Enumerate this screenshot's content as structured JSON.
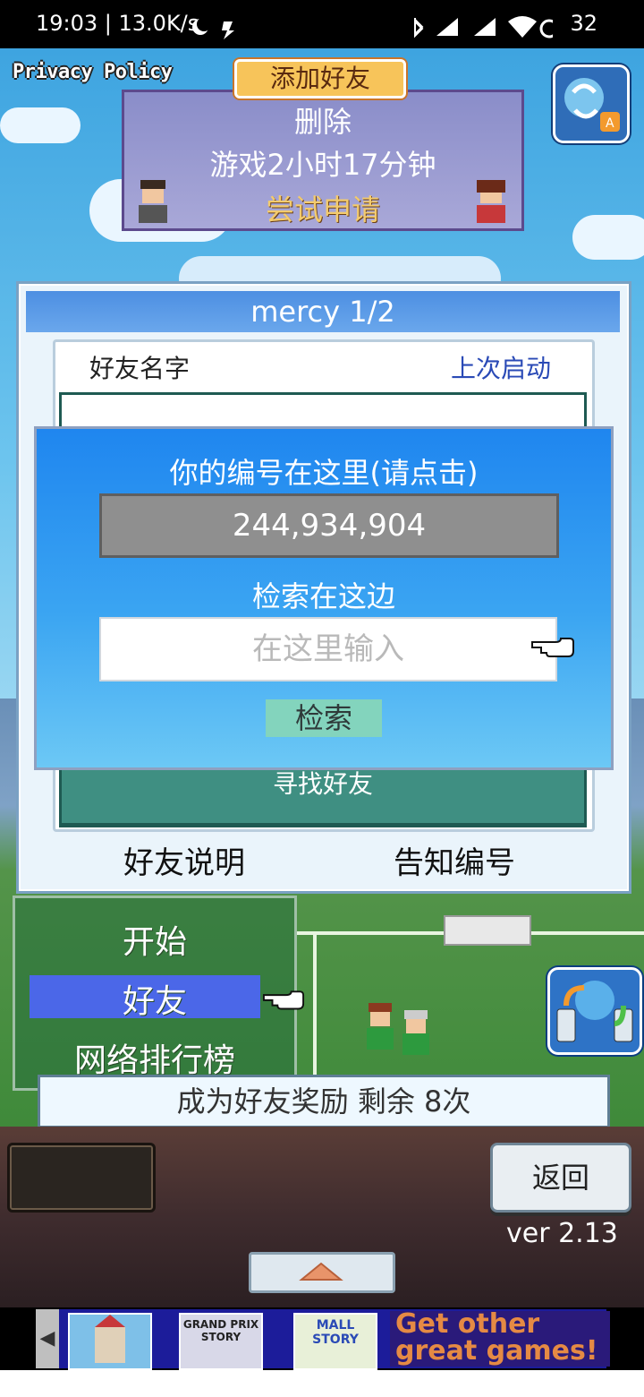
{
  "status_bar": {
    "time": "19:03 | 13.0K/s",
    "battery": "32"
  },
  "top": {
    "privacy_policy": "Privacy Policy",
    "add_friend_tab": "添加好友",
    "friend_box": {
      "line1": "删除",
      "line2": "游戏2小时17分钟",
      "line3": "尝试申请"
    }
  },
  "dialog": {
    "title": "mercy 1/2",
    "col_name": "好友名字",
    "col_last": "上次启动",
    "find_friend": "寻找好友",
    "explain_button": "好友说明",
    "notify_id_button": "告知编号"
  },
  "modal": {
    "title": "你的编号在这里(请点击)",
    "id_value": "244,934,904",
    "search_label": "检索在这边",
    "search_placeholder": "在这里输入",
    "search_button": "检索"
  },
  "menu": {
    "items": [
      "开始",
      "好友",
      "网络排行榜"
    ],
    "selected": "好友"
  },
  "reward_bar": "成为好友奖励 剩余 8次",
  "bottom": {
    "back_button": "返回",
    "version": "ver 2.13"
  },
  "ad": {
    "tile2": "GRAND PRIX STORY",
    "tile3": "MALL STORY",
    "cta": "Get other great games!"
  },
  "colors": {
    "dialog_title_bg": "#4d8fe2",
    "modal_bg": "#1f86ef",
    "menu_highlight": "#4b67e8",
    "find_friend_bg": "#3f8f82",
    "search_button_bg": "#83d4bd"
  }
}
